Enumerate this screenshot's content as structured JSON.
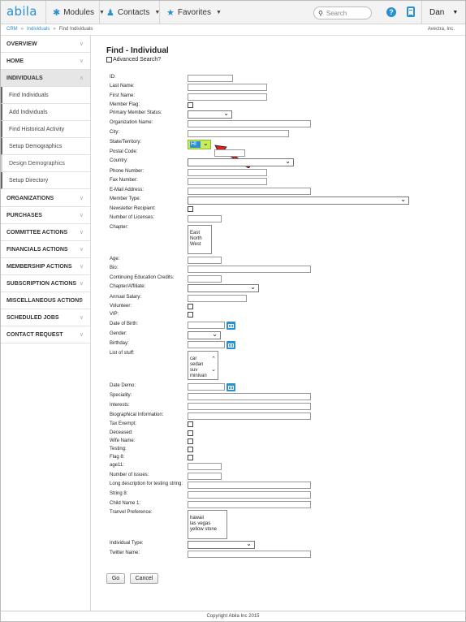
{
  "topbar": {
    "logo": "abila",
    "modules_label": "Modules",
    "contacts_label": "Contacts",
    "favorites_label": "Favorites",
    "search_placeholder": "Search",
    "help_icon": "?",
    "user_label": "Dan",
    "accent_color": "#2a8fd1"
  },
  "breadcrumb": {
    "items": [
      "CRM",
      "Individuals",
      "Find Individuals"
    ],
    "separator": "»",
    "org": "Avectra, Inc."
  },
  "sidebar": {
    "items": [
      {
        "label": "OVERVIEW"
      },
      {
        "label": "HOME"
      },
      {
        "label": "INDIVIDUALS"
      },
      {
        "label": "ORGANIZATIONS"
      },
      {
        "label": "PURCHASES"
      },
      {
        "label": "COMMITTEE ACTIONS"
      },
      {
        "label": "FINANCIALS ACTIONS"
      },
      {
        "label": "MEMBERSHIP ACTIONS"
      },
      {
        "label": "SUBSCRIPTION ACTIONS"
      },
      {
        "label": "MISCELLANEOUS ACTIONS"
      },
      {
        "label": "SCHEDULED JOBS"
      },
      {
        "label": "CONTACT REQUEST"
      }
    ],
    "sub_items": [
      {
        "label": "Find Individuals"
      },
      {
        "label": "Add Individuals"
      },
      {
        "label": "Find Historical Activity"
      },
      {
        "label": "Setup Demographics"
      },
      {
        "label": "Design Demographics"
      },
      {
        "label": "Setup Directory"
      }
    ]
  },
  "form": {
    "title": "Find - Individual",
    "advanced_search": "Advanced Search?",
    "labels": {
      "id": "ID:",
      "last_name": "Last Name:",
      "first_name": "First Name:",
      "member_flag": "Member Flag:",
      "primary_member_status": "Primary Member Status:",
      "organization_name": "Organization Name:",
      "city": "City:",
      "state": "State/Territory:",
      "postal_code": "Postal Code:",
      "country": "Country:",
      "phone": "Phone Number:",
      "fax": "Fax Number:",
      "email": "E-Mail Address:",
      "member_type": "Member Type:",
      "newsletter": "Newsletter Recipient:",
      "licenses": "Number of Licenses:",
      "chapter": "Chapter:",
      "age": "Age:",
      "bio": "Bio:",
      "ce_credits": "Continuing Education Credits:",
      "chapter_affiliate": "Chapter/Affiliate:",
      "annual_salary": "Annual Salary:",
      "volunteer": "Volunteer:",
      "vip": "VIP:",
      "dob": "Date of Birth:",
      "gender": "Gender:",
      "birthday": "Birthday:",
      "list_of_stuff": "List of stuff:",
      "date_demo": "Date Demo:",
      "speciality": "Speciality:",
      "interests": "Interests:",
      "bio_info": "Biographical Information:",
      "tax_exempt": "Tax Exempt:",
      "deceased": "Deceased:",
      "wife_name": "Wife Name:",
      "testing": "Testing:",
      "flag8": "Flag 8:",
      "age11": "age11:",
      "num_issues": "Number of issues:",
      "long_desc": "Long description for testing string:",
      "string8": "String 8:",
      "child_name": "Child Name 1:",
      "travel_pref": "Tranvel Preference:",
      "individual_type": "Individual Type:",
      "twitter": "Twitter Name:"
    },
    "state_value": "HI",
    "chapter_options": [
      "East",
      "North",
      "West"
    ],
    "stuff_options": [
      "car",
      "sedan",
      "suv",
      "minivan"
    ],
    "travel_options": [
      "hawaii",
      "las vegas",
      "yellow stone"
    ],
    "go_label": "Go",
    "cancel_label": "Cancel"
  },
  "footer": "Copyright Abila Inc 2015"
}
